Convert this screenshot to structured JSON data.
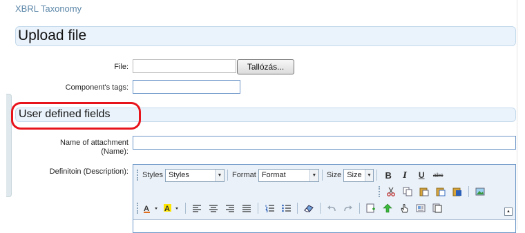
{
  "breadcrumb": "XBRL Taxonomy",
  "upload": {
    "heading": "Upload file",
    "file_label": "File:",
    "file_value": "",
    "browse_label": "Tallózás...",
    "tags_label": "Component's tags:",
    "tags_value": ""
  },
  "user_fields": {
    "heading": "User defined fields",
    "name_label": "Name of attachment (Name):",
    "name_value": "",
    "description_label": "Definitoin (Description):"
  },
  "editor": {
    "styles_label": "Styles",
    "styles_value": "Styles",
    "format_label": "Format",
    "format_value": "Format",
    "size_label": "Size",
    "size_value": "Size",
    "bold": "B",
    "italic": "I",
    "underline": "U",
    "strike": "abc"
  },
  "colors": {
    "link": "#5b86a8",
    "header_bg": "#eaf3fb",
    "highlight": "#e8141c"
  }
}
